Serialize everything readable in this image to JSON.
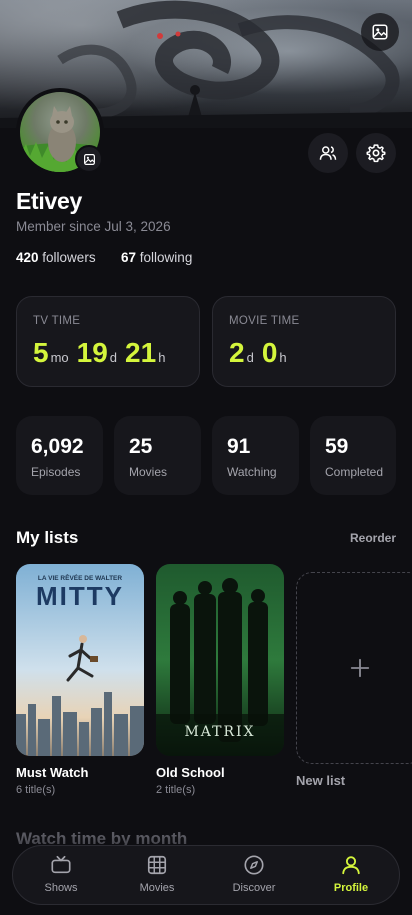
{
  "profile": {
    "name": "Etivey",
    "member_since": "Member since Jul 3, 2026",
    "followers_count": "420",
    "followers_label": "followers",
    "following_count": "67",
    "following_label": "following"
  },
  "time": {
    "tv_label": "TV TIME",
    "tv_months": "5",
    "tv_months_unit": "mo",
    "tv_days": "19",
    "tv_days_unit": "d",
    "tv_hours": "21",
    "tv_hours_unit": "h",
    "movie_label": "MOVIE TIME",
    "movie_days": "2",
    "movie_days_unit": "d",
    "movie_hours": "0",
    "movie_hours_unit": "h"
  },
  "stats": [
    {
      "value": "6,092",
      "label": "Episodes"
    },
    {
      "value": "25",
      "label": "Movies"
    },
    {
      "value": "91",
      "label": "Watching"
    },
    {
      "value": "59",
      "label": "Completed"
    }
  ],
  "lists": {
    "title": "My lists",
    "reorder": "Reorder",
    "items": [
      {
        "name": "Must Watch",
        "count": "6 title(s)",
        "poster_top": "LA VIE RÊVÉE DE WALTER",
        "poster_title": "MITTY"
      },
      {
        "name": "Old School",
        "count": "2 title(s)",
        "poster_title": "MATRIX"
      }
    ],
    "new_list": "New list"
  },
  "watch_time_title": "Watch time by month",
  "nav": [
    {
      "label": "Shows",
      "icon": "tv-icon"
    },
    {
      "label": "Movies",
      "icon": "film-icon"
    },
    {
      "label": "Discover",
      "icon": "compass-icon"
    },
    {
      "label": "Profile",
      "icon": "user-icon"
    }
  ],
  "colors": {
    "accent": "#d4f53c",
    "background": "#0e0e12",
    "card": "#17171c"
  }
}
